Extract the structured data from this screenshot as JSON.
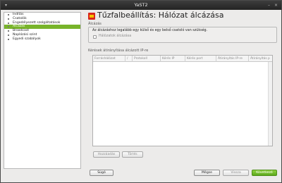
{
  "window": {
    "title": "YaST2"
  },
  "sidebar": {
    "items": [
      {
        "label": "Indítás",
        "selected": false
      },
      {
        "label": "Csatolók",
        "selected": false
      },
      {
        "label": "Engedélyezett szolgáltatások",
        "selected": false
      },
      {
        "label": "Álcázás",
        "selected": true
      },
      {
        "label": "Broadcast",
        "selected": false
      },
      {
        "label": "Naplózási szint",
        "selected": false
      },
      {
        "label": "Egyedi szabályok",
        "selected": false
      }
    ]
  },
  "header": {
    "title": "Tűzfalbeállítás: Hálózat álcázása",
    "icon": "firewall-icon"
  },
  "masquerade": {
    "label": "Álcázás",
    "info": "Az álcázáshoz legalább egy külső és egy belső csatoló van szükség.",
    "checkbox_label": "Hálózatok álcázása",
    "checked": false
  },
  "redirect": {
    "label": "Kérések átirányítása álcázott IP-re",
    "columns": [
      "Forráshálózat",
      "/",
      "Protokoll",
      "Kérés IP",
      "Kérés port",
      "Átirányítás IP-re",
      "Átirányítás p"
    ]
  },
  "buttons": {
    "add": "Hozzáadás",
    "remove": "Törlés",
    "help": "Súgó",
    "cancel": "Mégse",
    "back": "Vissza",
    "next": "Következő"
  },
  "colors": {
    "accent": "#78b42a",
    "next_button": "#6cb82a"
  }
}
